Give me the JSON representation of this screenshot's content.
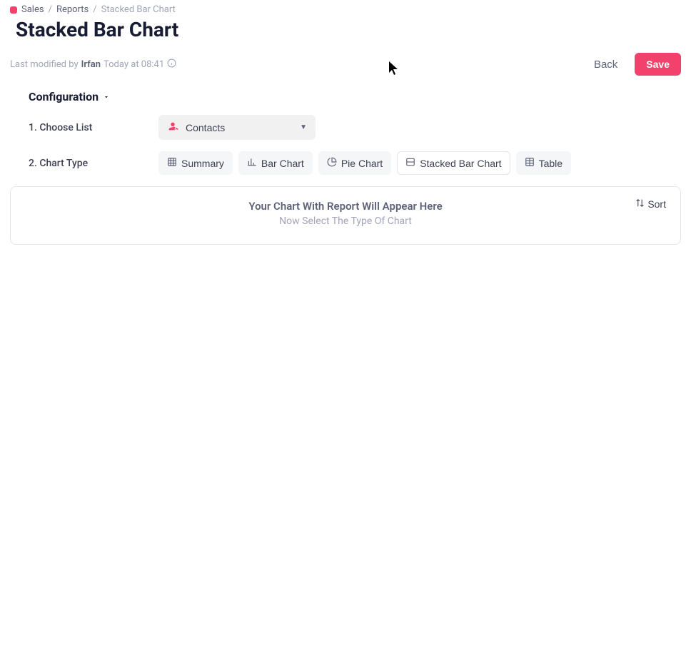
{
  "breadcrumb": {
    "items": [
      {
        "label": "Sales"
      },
      {
        "label": "Reports"
      },
      {
        "label": "Stacked Bar Chart"
      }
    ]
  },
  "page": {
    "title": "Stacked Bar Chart",
    "modified_prefix": "Last modified by",
    "modified_user": "Irfan",
    "modified_time": "Today at 08:41"
  },
  "actions": {
    "back_label": "Back",
    "save_label": "Save"
  },
  "config": {
    "title": "Configuration",
    "step1_label": "1. Choose List",
    "step1_selected": "Contacts",
    "step2_label": "2. Chart Type",
    "chart_types": [
      {
        "label": "Summary"
      },
      {
        "label": "Bar Chart"
      },
      {
        "label": "Pie Chart"
      },
      {
        "label": "Stacked Bar Chart"
      },
      {
        "label": "Table"
      }
    ]
  },
  "chart_panel": {
    "placeholder_title": "Your Chart With Report Will Appear Here",
    "placeholder_sub": "Now Select The Type Of Chart",
    "sort_label": "Sort"
  }
}
